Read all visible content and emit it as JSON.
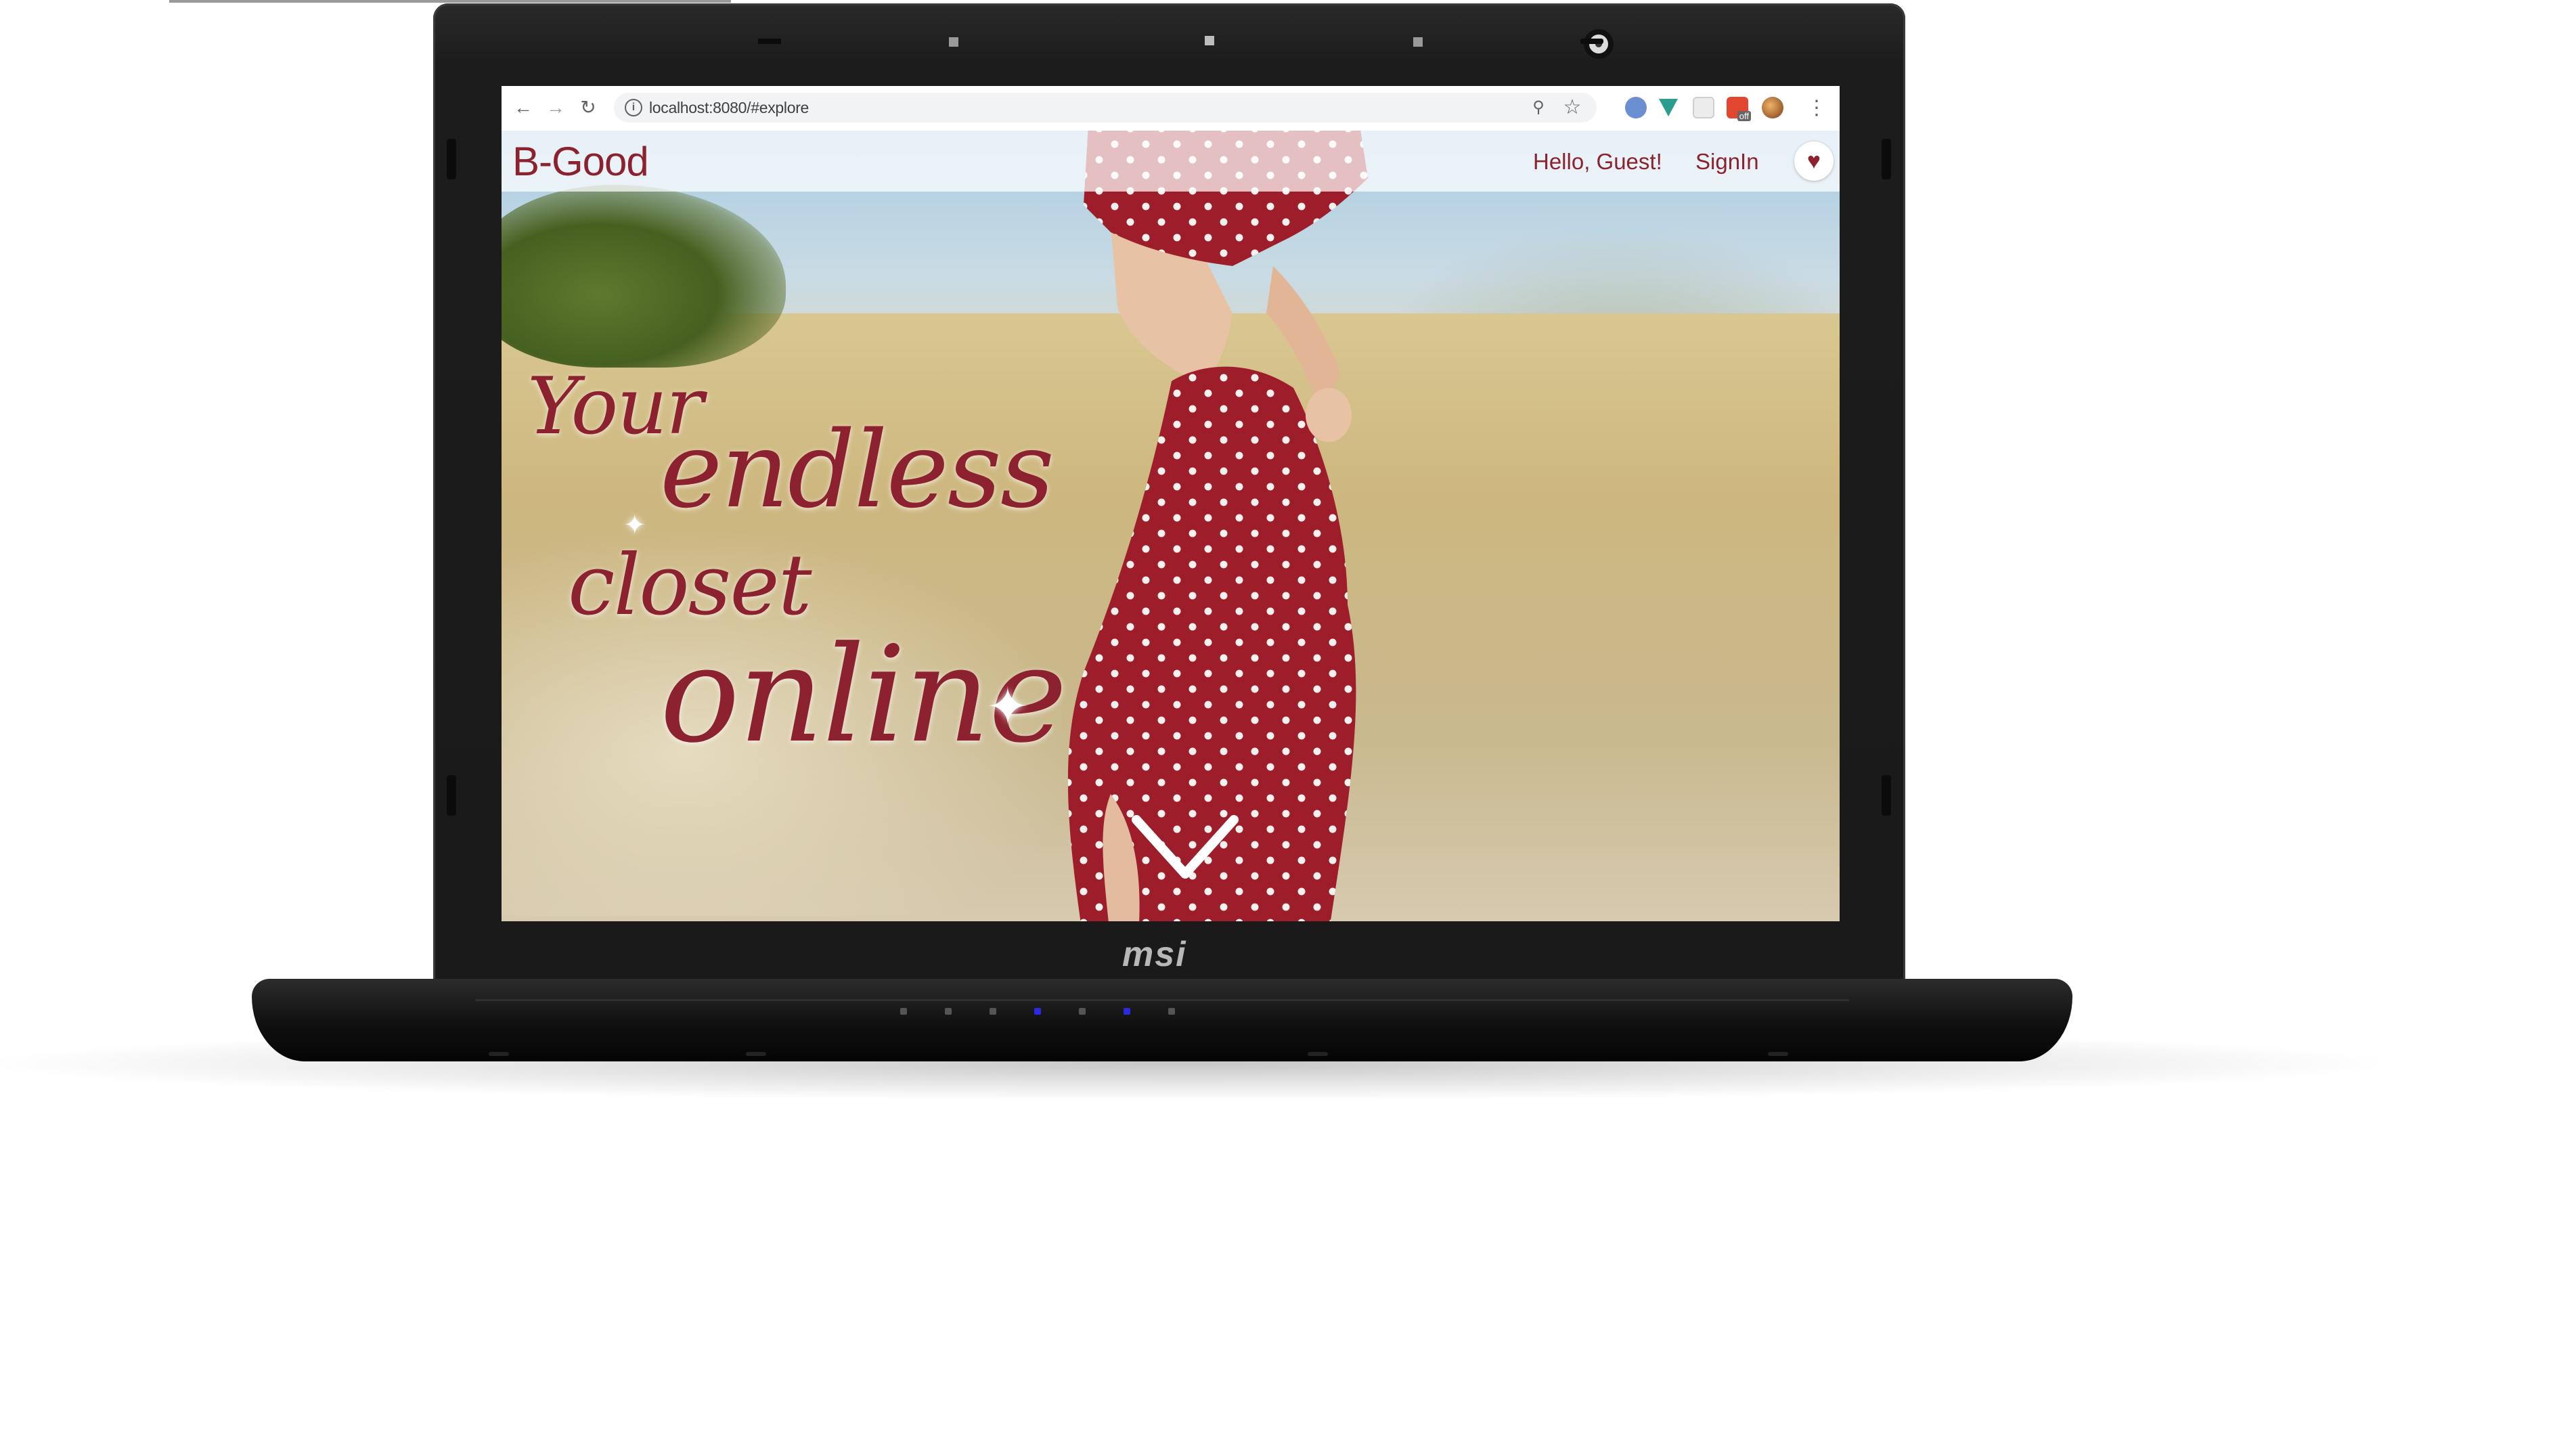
{
  "browser": {
    "url": "localhost:8080/#explore",
    "back_icon": "←",
    "forward_icon": "→",
    "reload_icon": "↻",
    "info_icon": "i",
    "zoom_icon": "⚲",
    "star_icon": "☆",
    "menu_icon": "⋮"
  },
  "site": {
    "brand": "B-Good",
    "greeting": "Hello, Guest!",
    "signin": "SignIn",
    "heart_icon": "♥"
  },
  "hero": {
    "tagline": {
      "line1": "Your",
      "line2": "endless",
      "line3": "closet",
      "line4": "online"
    }
  },
  "laptop": {
    "brand": "msi"
  },
  "colors": {
    "brand": "#8c2230",
    "dress": "#9e1d2a",
    "laptop_body": "#1a1a1a"
  }
}
